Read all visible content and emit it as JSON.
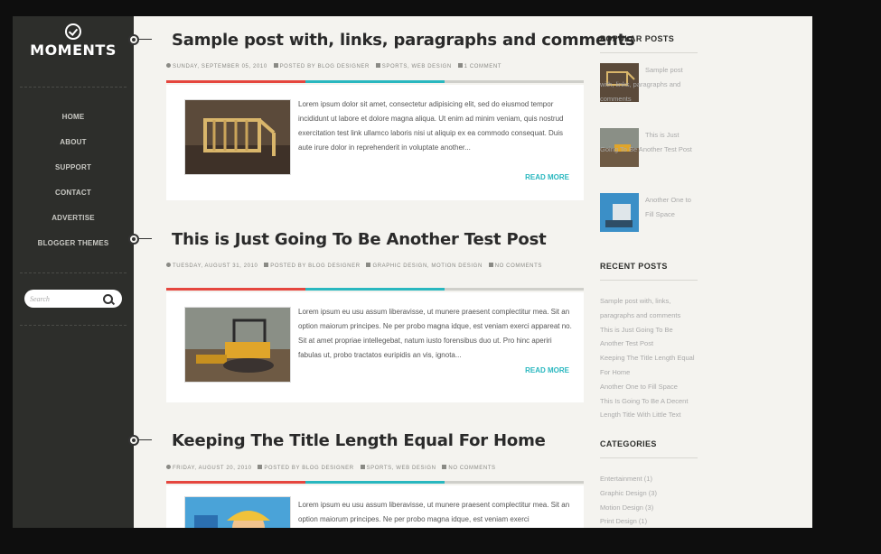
{
  "logo": {
    "title": "MOMENTS",
    "icon": "check-circle-icon"
  },
  "nav": {
    "items": [
      "HOME",
      "ABOUT",
      "SUPPORT",
      "CONTACT",
      "ADVERTISE",
      "BLOGGER THEMES"
    ]
  },
  "search": {
    "placeholder": "Search",
    "icon": "search-icon"
  },
  "posts": [
    {
      "title": "Sample post with, links, paragraphs and comments",
      "date": "SUNDAY, SEPTEMBER 05, 2010",
      "author": "POSTED BY BLOG DESIGNER",
      "labels": "SPORTS, WEB DESIGN",
      "comments": "1 COMMENT",
      "excerpt": "Lorem ipsum dolor sit amet, consectetur adipisicing elit, sed do eiusmod tempor incididunt ut labore et dolore magna aliqua. Ut enim ad minim veniam, quis nostrud exercitation test link ullamco laboris nisi ut aliquip ex ea commodo consequat. Duis aute irure dolor in reprehenderit in voluptate another...",
      "read_more": "READ MORE"
    },
    {
      "title": "This is Just Going To Be Another Test Post",
      "date": "TUESDAY, AUGUST 31, 2010",
      "author": "POSTED BY BLOG DESIGNER",
      "labels": "GRAPHIC DESIGN, MOTION DESIGN",
      "comments": "NO COMMENTS",
      "excerpt": "Lorem ipsum eu usu assum liberavisse, ut munere praesent complectitur mea. Sit an option maiorum principes. Ne per probo magna idque, est veniam exerci appareat no. Sit at amet propriae intellegebat, natum iusto forensibus duo ut. Pro hinc aperiri fabulas ut, probo tractatos euripidis an vis, ignota...",
      "read_more": "READ MORE"
    },
    {
      "title": "Keeping The Title Length Equal For Home",
      "date": "FRIDAY, AUGUST 20, 2010",
      "author": "POSTED BY BLOG DESIGNER",
      "labels": "SPORTS, WEB DESIGN",
      "comments": "NO COMMENTS",
      "excerpt": "Lorem ipsum eu usu assum liberavisse, ut munere praesent complectitur mea. Sit an option maiorum principes. Ne per probo magna idque, est veniam exerci",
      "read_more": ""
    }
  ],
  "popular": {
    "heading": "POPULAR POSTS",
    "items": [
      {
        "title": "Sample post with, links, paragraphs and comments"
      },
      {
        "title": "This is Just Going To Be Another Test Post"
      },
      {
        "title": "Another One to Fill Space"
      }
    ]
  },
  "recent": {
    "heading": "RECENT POSTS",
    "items": [
      "Sample post with, links, paragraphs and comments",
      "This is Just Going To Be Another Test Post",
      "Keeping The Title Length Equal For Home",
      "Another One to Fill Space",
      "This Is Going To Be A Decent Length Title With Little Text"
    ]
  },
  "categories": {
    "heading": "CATEGORIES",
    "items": [
      "Entertainment (1)",
      "Graphic Design (3)",
      "Motion Design (3)",
      "Print Design (1)"
    ]
  },
  "colors": {
    "sidebar": "#2d2e2b",
    "accent_red": "#e5463e",
    "accent_cyan": "#29b7bf",
    "page_bg": "#f4f3ef"
  }
}
